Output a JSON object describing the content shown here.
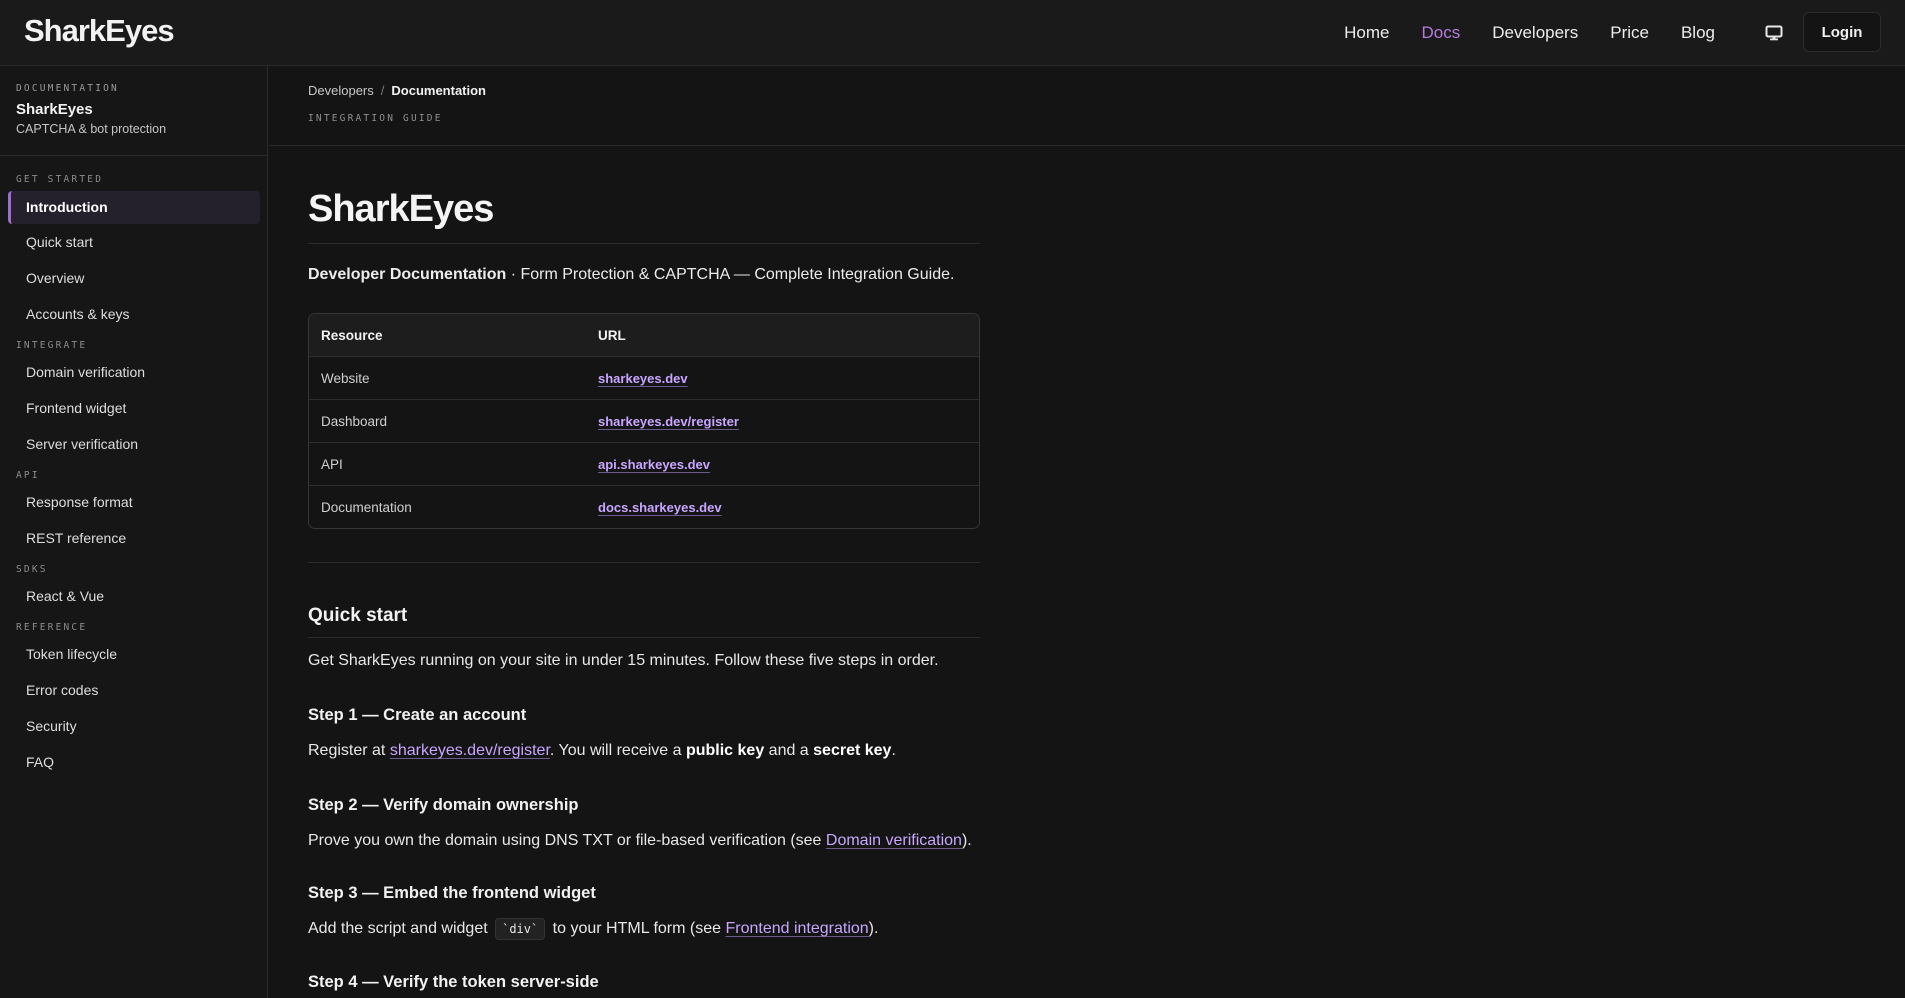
{
  "header": {
    "logo": "SharkEyes",
    "nav": [
      {
        "label": "Home",
        "active": false
      },
      {
        "label": "Docs",
        "active": true
      },
      {
        "label": "Developers",
        "active": false
      },
      {
        "label": "Price",
        "active": false
      },
      {
        "label": "Blog",
        "active": false
      }
    ],
    "display_icon": "monitor-icon",
    "login_label": "Login",
    "accent_color": "#b57be0"
  },
  "sidebar": {
    "kicker": "DOCUMENTATION",
    "title": "SharkEyes",
    "subtitle": "CAPTCHA & bot protection",
    "sections": [
      {
        "title": "GET STARTED",
        "items": [
          "Introduction",
          "Quick start",
          "Overview",
          "Accounts & keys"
        ]
      },
      {
        "title": "INTEGRATE",
        "items": [
          "Domain verification",
          "Frontend widget",
          "Server verification"
        ]
      },
      {
        "title": "API",
        "items": [
          "Response format",
          "REST reference"
        ]
      },
      {
        "title": "SDKS",
        "items": [
          "React & Vue"
        ]
      },
      {
        "title": "REFERENCE",
        "items": [
          "Token lifecycle",
          "Error codes",
          "Security",
          "FAQ"
        ]
      }
    ],
    "active_item": "Introduction"
  },
  "breadcrumb": {
    "parent": "Developers",
    "separator": "/",
    "current": "Documentation",
    "kicker": "INTEGRATION GUIDE"
  },
  "main": {
    "title": "SharkEyes",
    "lead_bold": "Developer Documentation",
    "lead_rest": " · Form Protection & CAPTCHA — Complete Integration Guide.",
    "table": {
      "headers": [
        "Resource",
        "URL"
      ],
      "rows": [
        [
          "Website",
          "sharkeyes.dev"
        ],
        [
          "Dashboard",
          "sharkeyes.dev/register"
        ],
        [
          "API",
          "api.sharkeyes.dev"
        ],
        [
          "Documentation",
          "docs.sharkeyes.dev"
        ]
      ]
    },
    "quick_start": {
      "heading": "Quick start",
      "intro": "Get SharkEyes running on your site in under 15 minutes. Follow these five steps in order.",
      "step1": {
        "title": "Step 1 — Create an account",
        "t1": "Register at ",
        "link": "sharkeyes.dev/register",
        "t2": ". You will receive a ",
        "b1": "public key",
        "t3": " and a ",
        "b2": "secret key",
        "t4": "."
      },
      "step2": {
        "title": "Step 2 — Verify domain ownership",
        "t1": "Prove you own the domain using DNS TXT or file-based verification (see ",
        "link": "Domain verification",
        "t2": ")."
      },
      "step3": {
        "title": "Step 3 — Embed the frontend widget",
        "t1": "Add the script and widget ",
        "code": "`div`",
        "t2": " to your HTML form (see ",
        "link": "Frontend integration",
        "t3": ")."
      },
      "step4": {
        "title": "Step 4 — Verify the token server-side"
      }
    }
  }
}
